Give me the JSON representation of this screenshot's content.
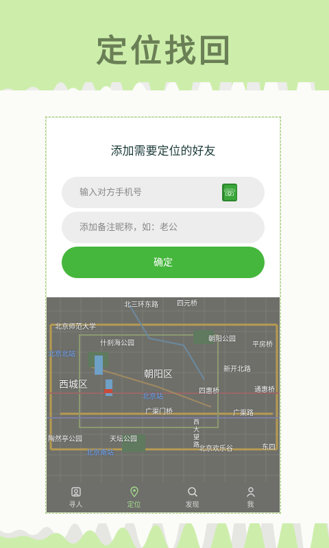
{
  "hero": {
    "title": "定位找回"
  },
  "form": {
    "title": "添加需要定位的好友",
    "phone_placeholder": "输入对方手机号",
    "note_placeholder": "添加备注昵称，如：老公",
    "confirm_label": "确定"
  },
  "map": {
    "labels": [
      "北三环东路",
      "四元桥",
      "北京师范大学",
      "什刹海公园",
      "朝阳公园",
      "平房桥",
      "北京北站",
      "新开北路",
      "西城区",
      "朝阳区",
      "北京站",
      "四惠桥",
      "通惠桥",
      "广渠门桥",
      "广渠路",
      "陶然亭公园",
      "天坛公园",
      "北京南站",
      "北京欢乐谷",
      "西大望路",
      "东四"
    ]
  },
  "tabs": [
    {
      "label": "寻人",
      "icon": "person-search-icon"
    },
    {
      "label": "定位",
      "icon": "location-pin-icon"
    },
    {
      "label": "发现",
      "icon": "search-icon"
    },
    {
      "label": "我",
      "icon": "user-icon"
    }
  ],
  "colors": {
    "background": "#cdeeab",
    "accent": "#46b73d",
    "title": "#6a7f55"
  }
}
